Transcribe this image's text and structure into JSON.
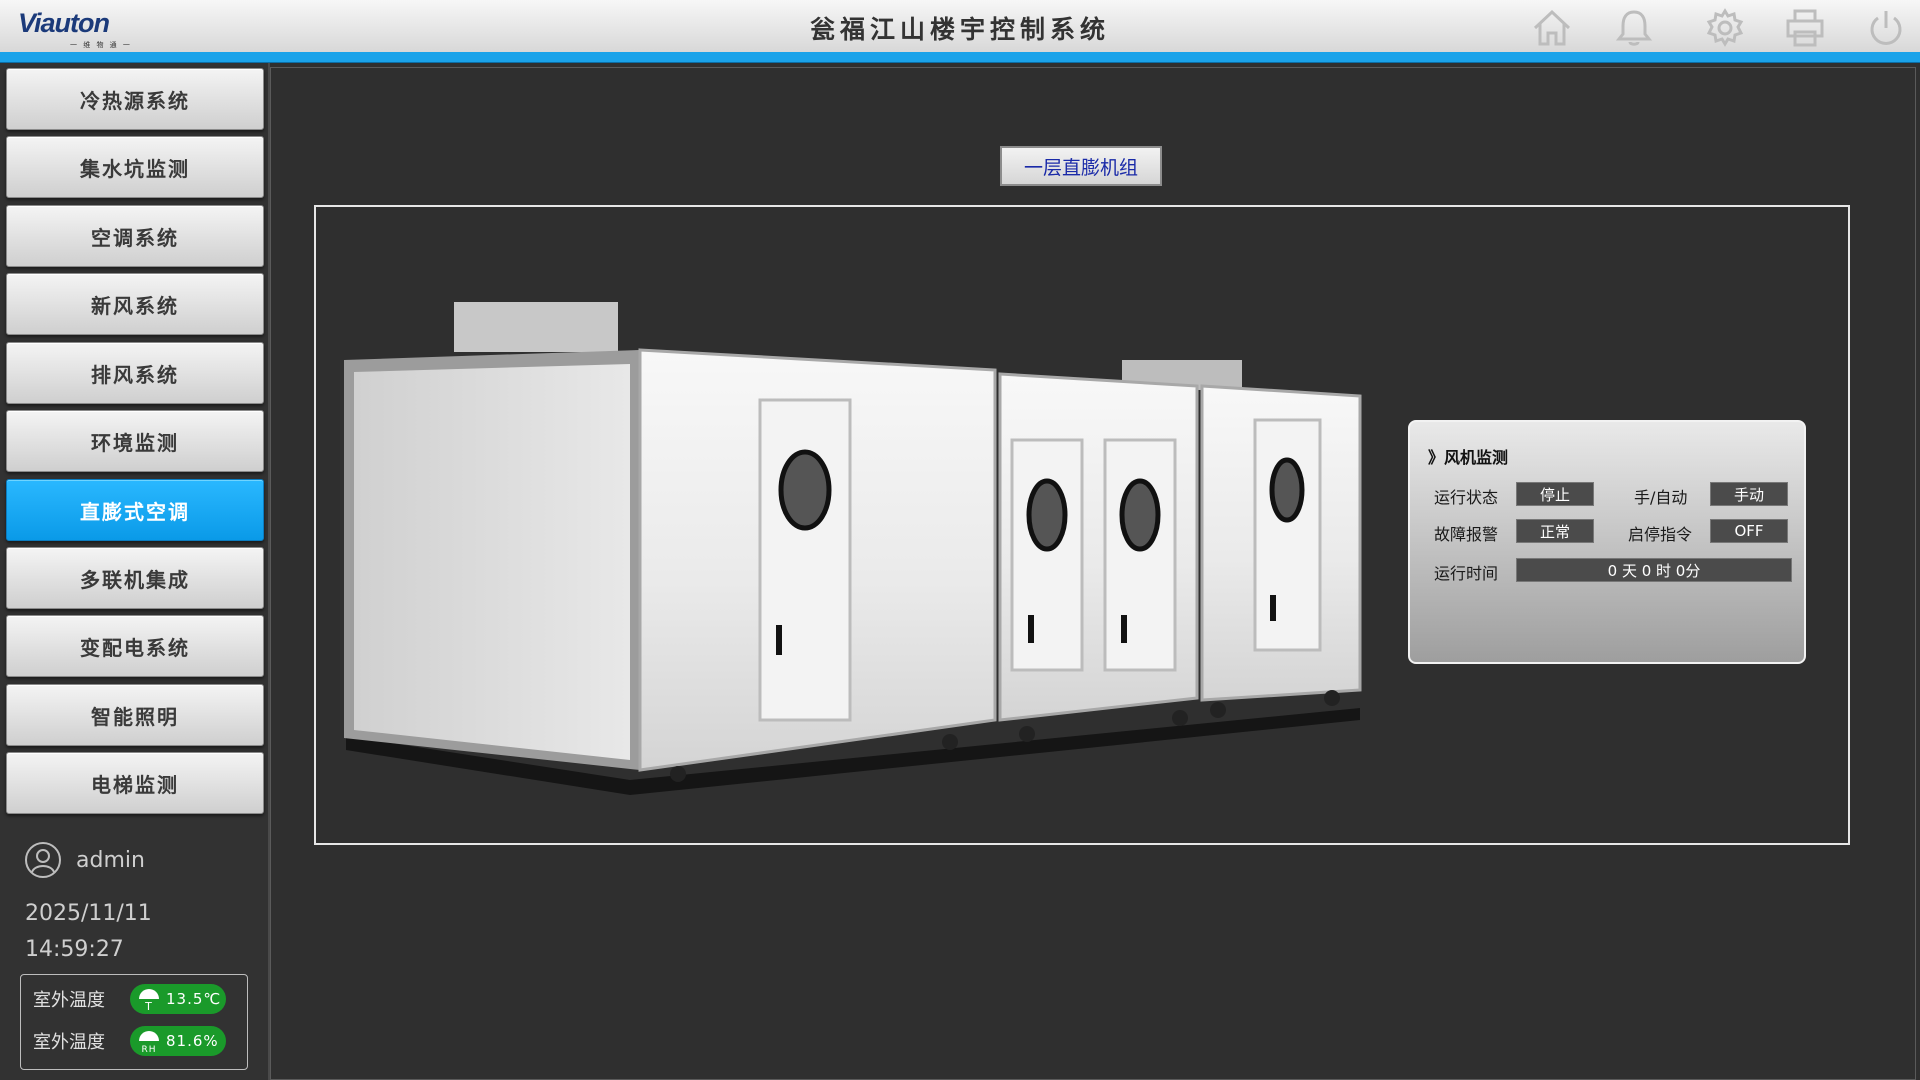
{
  "header": {
    "logo_text": "Viauton",
    "logo_sub": "一 维 物 通 一",
    "title": "瓮福江山楼宇控制系统",
    "icons": [
      "home-icon",
      "bell-icon",
      "gear-icon",
      "printer-icon",
      "power-icon"
    ]
  },
  "sidebar": {
    "items": [
      {
        "label": "冷热源系统"
      },
      {
        "label": "集水坑监测"
      },
      {
        "label": "空调系统"
      },
      {
        "label": "新风系统"
      },
      {
        "label": "排风系统"
      },
      {
        "label": "环境监测"
      },
      {
        "label": "直膨式空调"
      },
      {
        "label": "多联机集成"
      },
      {
        "label": "变配电系统"
      },
      {
        "label": "智能照明"
      },
      {
        "label": "电梯监测"
      }
    ],
    "active_index": 6,
    "user": "admin",
    "date": "2025/11/11",
    "time": "14:59:27",
    "env": [
      {
        "label": "室外温度",
        "value": "13.5℃"
      },
      {
        "label": "室外温度",
        "value": "81.6%"
      }
    ]
  },
  "main": {
    "unit_button": "一层直膨机组",
    "panel": {
      "title": "》风机监测",
      "run_state_label": "运行状态",
      "run_state_value": "停止",
      "manual_auto_label": "手/自动",
      "manual_auto_value": "手动",
      "fault_label": "故障报警",
      "fault_value": "正常",
      "start_stop_label": "启停指令",
      "start_stop_value": "OFF",
      "run_time_label": "运行时间",
      "run_time_value": "0 天 0 时 0分"
    }
  },
  "colors": {
    "accent": "#1aa3ea",
    "active_nav": "#0a9ae8",
    "env_pill": "#1a9a2a",
    "unit_button_text": "#1a2aa8"
  }
}
